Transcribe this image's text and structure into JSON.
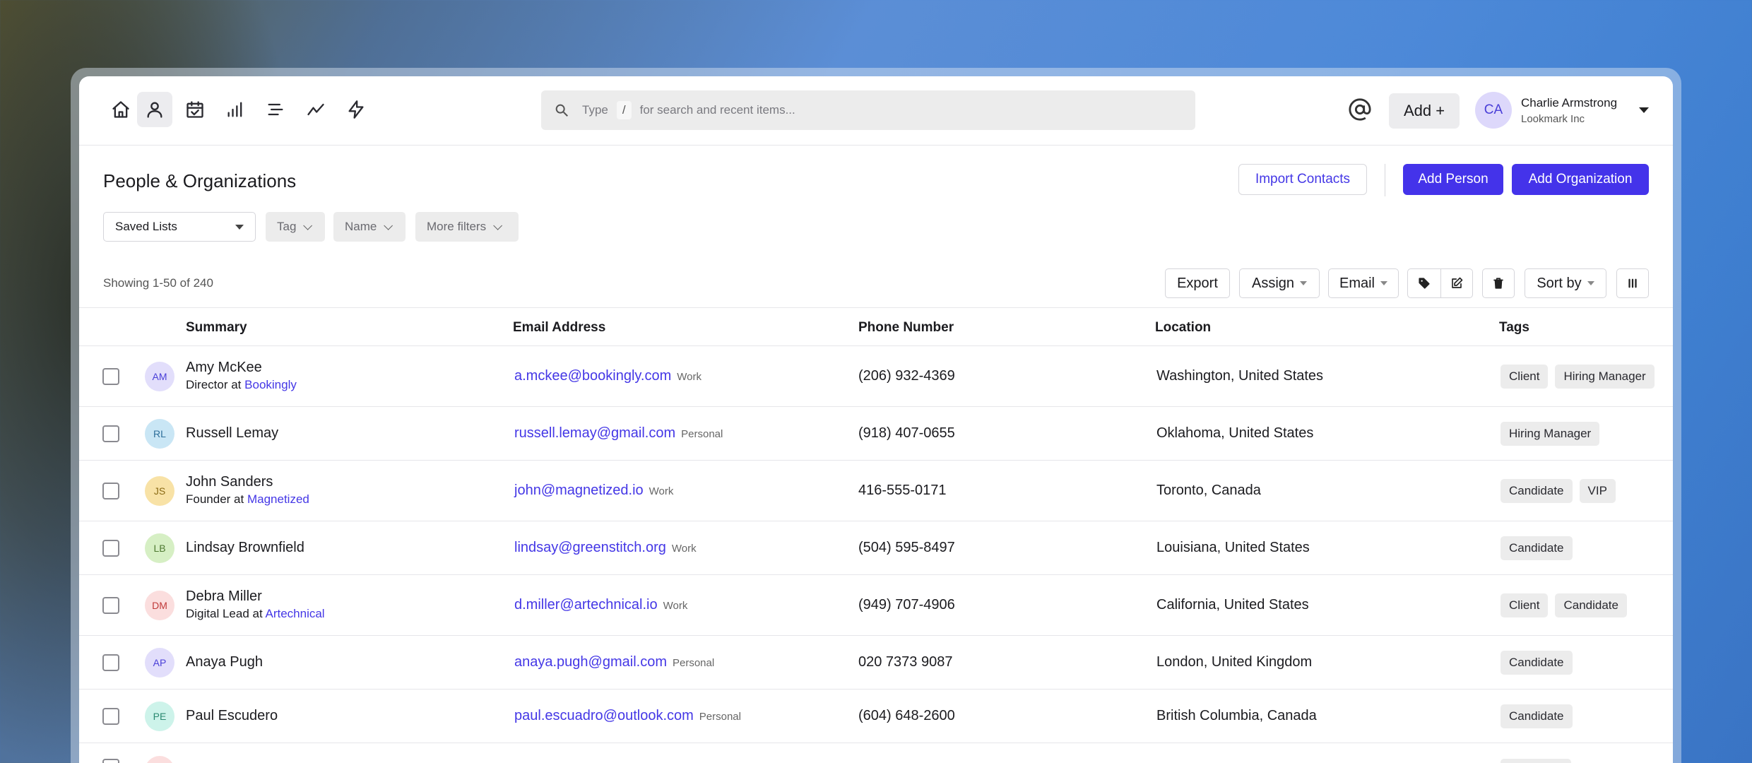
{
  "nav": [
    {
      "name": "home-icon"
    },
    {
      "name": "person-icon",
      "active": true
    },
    {
      "name": "calendar-check-icon"
    },
    {
      "name": "bar-signal-icon"
    },
    {
      "name": "list-icon"
    },
    {
      "name": "trend-line-icon"
    },
    {
      "name": "lightning-icon"
    }
  ],
  "search": {
    "prefix": "Type",
    "key": "/",
    "suffix": "for search and recent items..."
  },
  "topbar": {
    "add_label": "Add +",
    "user_initials": "CA",
    "user_name": "Charlie Armstrong",
    "user_org": "Lookmark Inc"
  },
  "header": {
    "title": "People & Organizations",
    "import_label": "Import Contacts",
    "add_person_label": "Add Person",
    "add_org_label": "Add Organization"
  },
  "filters": {
    "saved_lists": "Saved Lists",
    "tag": "Tag",
    "name": "Name",
    "more": "More filters"
  },
  "toolbar": {
    "showing": "Showing 1-50 of 240",
    "export": "Export",
    "assign": "Assign",
    "email": "Email",
    "sort": "Sort by"
  },
  "columns": [
    "Summary",
    "Email Address",
    "Phone Number",
    "Location",
    "Tags"
  ],
  "rows": [
    {
      "initials": "AM",
      "name": "Amy McKee",
      "role": "Director at",
      "company": "Bookingly",
      "email": "a.mckee@bookingly.com",
      "email_type": "Work",
      "phone": "(206) 932-4369",
      "location": "Washington, United States",
      "tags": [
        "Client",
        "Hiring Manager"
      ],
      "avatar_bg": "#e2defb",
      "avatar_fg": "#4a3fd8"
    },
    {
      "initials": "RL",
      "name": "Russell Lemay",
      "role": "",
      "company": "",
      "email": "russell.lemay@gmail.com",
      "email_type": "Personal",
      "phone": "(918) 407-0655",
      "location": "Oklahoma, United States",
      "tags": [
        "Hiring Manager"
      ],
      "avatar_bg": "#c9e6f5",
      "avatar_fg": "#2e6f9a"
    },
    {
      "initials": "JS",
      "name": "John Sanders",
      "role": "Founder at",
      "company": "Magnetized",
      "email": "john@magnetized.io",
      "email_type": "Work",
      "phone": "416-555-0171",
      "location": "Toronto, Canada",
      "tags": [
        "Candidate",
        "VIP"
      ],
      "avatar_bg": "#f8e2a6",
      "avatar_fg": "#8a6a14"
    },
    {
      "initials": "LB",
      "name": "Lindsay Brownfield",
      "role": "",
      "company": "",
      "email": "lindsay@greenstitch.org",
      "email_type": "Work",
      "phone": "(504) 595-8497",
      "location": "Louisiana, United States",
      "tags": [
        "Candidate"
      ],
      "avatar_bg": "#d6efc4",
      "avatar_fg": "#4f7a32"
    },
    {
      "initials": "DM",
      "name": "Debra Miller",
      "role": "Digital Lead at",
      "company": "Artechnical",
      "email": "d.miller@artechnical.io",
      "email_type": "Work",
      "phone": "(949) 707-4906",
      "location": "California, United States",
      "tags": [
        "Client",
        "Candidate"
      ],
      "avatar_bg": "#fbdede",
      "avatar_fg": "#c03a3a"
    },
    {
      "initials": "AP",
      "name": "Anaya Pugh",
      "role": "",
      "company": "",
      "email": "anaya.pugh@gmail.com",
      "email_type": "Personal",
      "phone": "020 7373 9087",
      "location": "London, United Kingdom",
      "tags": [
        "Candidate"
      ],
      "avatar_bg": "#e2defb",
      "avatar_fg": "#4a3fd8"
    },
    {
      "initials": "PE",
      "name": "Paul Escudero",
      "role": "",
      "company": "",
      "email": "paul.escuadro@outlook.com",
      "email_type": "Personal",
      "phone": "(604) 648-2600",
      "location": "British Columbia, Canada",
      "tags": [
        "Candidate"
      ],
      "avatar_bg": "#cdf3ea",
      "avatar_fg": "#2b8a72"
    }
  ]
}
